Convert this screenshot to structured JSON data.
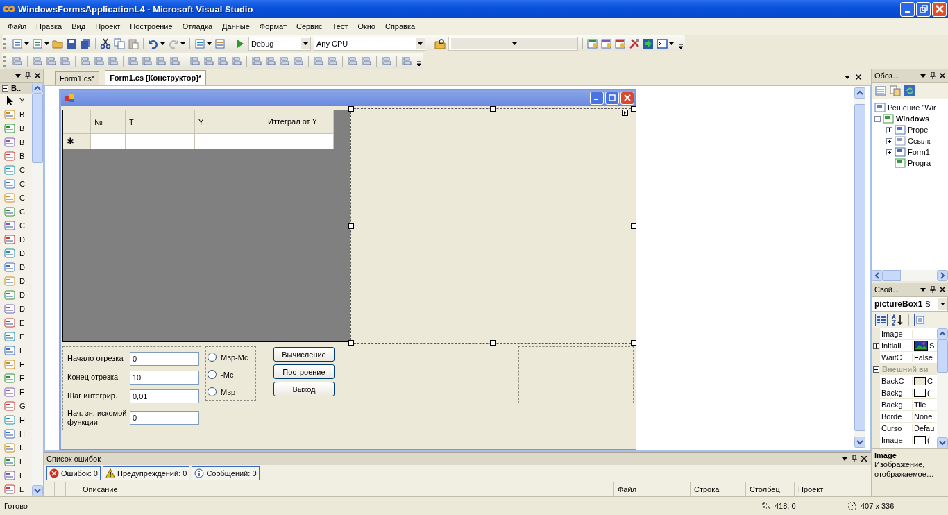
{
  "window": {
    "title": "WindowsFormsApplicationL4 - Microsoft Visual Studio"
  },
  "menu": [
    "Файл",
    "Правка",
    "Вид",
    "Проект",
    "Построение",
    "Отладка",
    "Данные",
    "Формат",
    "Сервис",
    "Тест",
    "Окно",
    "Справка"
  ],
  "toolbar": {
    "configuration": "Debug",
    "platform": "Any CPU"
  },
  "toolbox": {
    "header": "В..",
    "items": [
      "У",
      "B",
      "B",
      "B",
      "B",
      "C",
      "C",
      "C",
      "C",
      "C",
      "D",
      "D",
      "D",
      "D",
      "D",
      "D",
      "E",
      "E",
      "F",
      "F",
      "F",
      "F",
      "G",
      "H",
      "H",
      "I.",
      "L",
      "L",
      "L"
    ]
  },
  "document_tabs": [
    {
      "label": "Form1.cs*",
      "selected": false
    },
    {
      "label": "Form1.cs [Конструктор]*",
      "selected": true
    }
  ],
  "form_designer": {
    "grid": {
      "columns": [
        "№",
        "T",
        "Y",
        "Иттеграл от Y"
      ],
      "new_row_marker": "✱"
    },
    "fields": [
      {
        "label": "Начало отрезка",
        "value": "0"
      },
      {
        "label": "Конец отрезка",
        "value": "10"
      },
      {
        "label": "Шаг интегрир.",
        "value": "0,01"
      },
      {
        "label": "Нач. зн. искомой функции",
        "value": "0"
      }
    ],
    "radios": [
      {
        "label": "Мвр-Мс",
        "selected": false
      },
      {
        "label": "-Мс",
        "selected": false
      },
      {
        "label": "Мвр",
        "selected": false
      }
    ],
    "buttons": [
      "Вычисление",
      "Построение",
      "Выход"
    ]
  },
  "solution_explorer": {
    "title": "Обоз…",
    "tree": [
      {
        "kind": "solution",
        "label": "Решение \"Wir",
        "children": [
          {
            "kind": "project",
            "label": "Windows",
            "expanded": true,
            "children": [
              {
                "kind": "properties",
                "label": "Prope",
                "expanded": false
              },
              {
                "kind": "references",
                "label": "Ссылк",
                "expanded": false
              },
              {
                "kind": "form",
                "label": "Form1",
                "expanded": false
              },
              {
                "kind": "code",
                "label": "Progra"
              }
            ]
          }
        ]
      }
    ]
  },
  "properties": {
    "title": "Свой…",
    "object": "pictureBox1",
    "object_type": "S",
    "rows": [
      {
        "kind": "property",
        "name": "Image"
      },
      {
        "kind": "image",
        "name": "InitialI",
        "value": "S",
        "expanded": false
      },
      {
        "kind": "property",
        "name": "WaitC",
        "value": "False"
      },
      {
        "kind": "category",
        "name": "Внешний ви",
        "expanded": true
      },
      {
        "kind": "swatch",
        "name": "BackC",
        "color": "#ece9d8",
        "value": "C"
      },
      {
        "kind": "swatch",
        "name": "Backg",
        "color": "#ffffff",
        "value": "("
      },
      {
        "kind": "property",
        "name": "Backg",
        "value": "Tile"
      },
      {
        "kind": "property",
        "name": "Borde",
        "value": "None"
      },
      {
        "kind": "property",
        "name": "Curso",
        "value": "Defau"
      },
      {
        "kind": "swatch",
        "name": "Image",
        "color": "#ffffff",
        "value": "("
      }
    ],
    "description": {
      "title": "Image",
      "text": "Изображение, отображаемое…"
    }
  },
  "error_list": {
    "title": "Список ошибок",
    "filters": [
      {
        "kind": "error",
        "label": "Ошибок: 0"
      },
      {
        "kind": "warning",
        "label": "Предупреждений: 0"
      },
      {
        "kind": "info",
        "label": "Сообщений: 0"
      }
    ],
    "columns": [
      "Описание",
      "Файл",
      "Строка",
      "Столбец",
      "Проект"
    ]
  },
  "status_bar": {
    "text": "Готово",
    "position": "418, 0",
    "size": "407 x 336"
  }
}
